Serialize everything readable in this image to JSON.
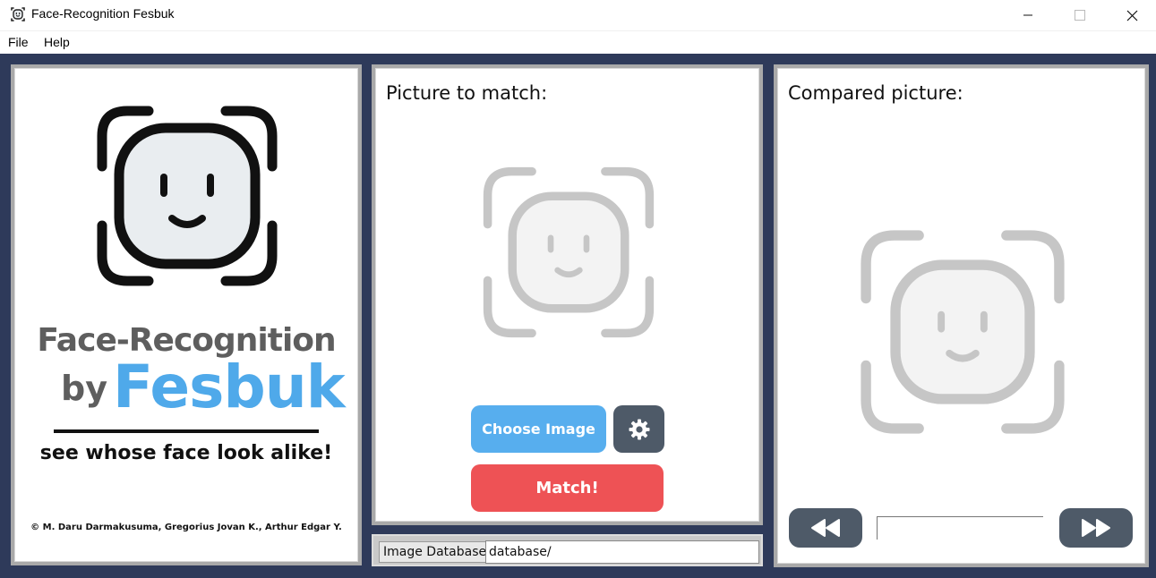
{
  "window": {
    "title": "Face-Recognition Fesbuk"
  },
  "menu": {
    "items": [
      "File",
      "Help"
    ]
  },
  "branding": {
    "line1": "Face-Recognition",
    "by": "by",
    "name": "Fesbuk",
    "tagline": "see whose face look alike!",
    "credits": "© M. Daru Darmakusuma, Gregorius Jovan K., Arthur Edgar Y."
  },
  "match_panel": {
    "title": "Picture to match:",
    "choose_label": "Choose Image",
    "match_label": "Match!",
    "settings_icon": "gear-icon"
  },
  "database": {
    "label": "Image Database:",
    "value": "database/"
  },
  "compared_panel": {
    "title": "Compared picture:",
    "prev_icon": "rewind-icon",
    "next_icon": "fast-forward-icon",
    "index_value": ""
  },
  "colors": {
    "background": "#2e3a5a",
    "accent_blue": "#57aeee",
    "accent_red": "#ee5255",
    "dark_button": "#4e5a68",
    "brand_blue": "#4fa9ea"
  }
}
